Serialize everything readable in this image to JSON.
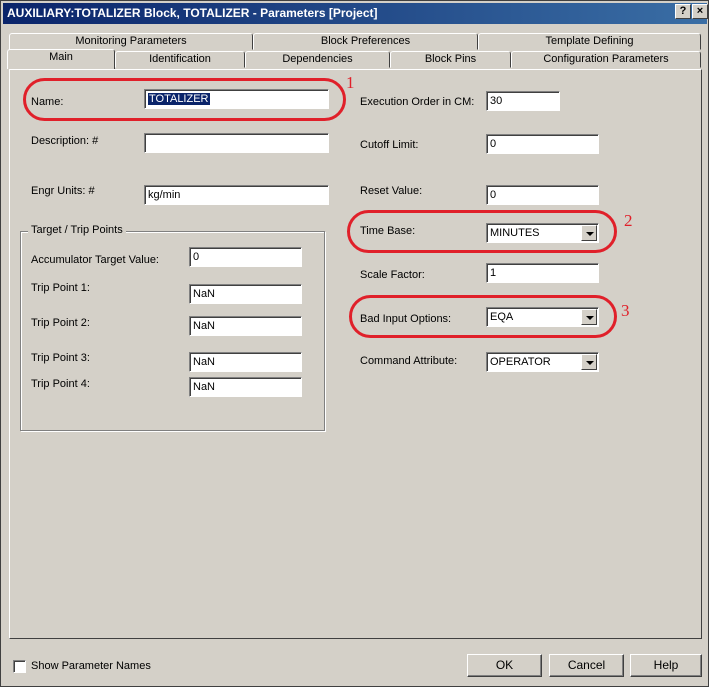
{
  "window": {
    "title": "AUXILIARY:TOTALIZER Block, TOTALIZER - Parameters [Project]",
    "help_glyph": "?",
    "close_glyph": "×"
  },
  "tabs_row1": [
    "Monitoring Parameters",
    "Block Preferences",
    "Template Defining"
  ],
  "tabs_row2": [
    "Main",
    "Identification",
    "Dependencies",
    "Block Pins",
    "Configuration Parameters"
  ],
  "left": {
    "name_label": "Name:",
    "name_value": "TOTALIZER",
    "description_label": "Description: #",
    "description_value": "",
    "engr_units_label": "Engr Units: #",
    "engr_units_value": "kg/min"
  },
  "group": {
    "title": "Target / Trip Points",
    "accumulator_label": "Accumulator Target Value:",
    "accumulator_value": "0",
    "trip1_label": "Trip Point 1:",
    "trip1_value": "NaN",
    "trip2_label": "Trip Point 2:",
    "trip2_value": "NaN",
    "trip3_label": "Trip Point 3:",
    "trip3_value": "NaN",
    "trip4_label": "Trip Point 4:",
    "trip4_value": "NaN"
  },
  "right": {
    "exec_order_label": "Execution Order in CM:",
    "exec_order_value": "30",
    "cutoff_label": "Cutoff Limit:",
    "cutoff_value": "0",
    "reset_label": "Reset Value:",
    "reset_value": "0",
    "time_base_label": "Time Base:",
    "time_base_value": "MINUTES",
    "scale_label": "Scale Factor:",
    "scale_value": "1",
    "bad_input_label": "Bad Input Options:",
    "bad_input_value": "EQA",
    "command_label": "Command Attribute:",
    "command_value": "OPERATOR"
  },
  "annotations": {
    "one": "1",
    "two": "2",
    "three": "3",
    "color": "#e0202a"
  },
  "footer": {
    "show_param_names_label": "Show Parameter Names",
    "ok_label": "OK",
    "cancel_label": "Cancel",
    "help_label": "Help"
  }
}
